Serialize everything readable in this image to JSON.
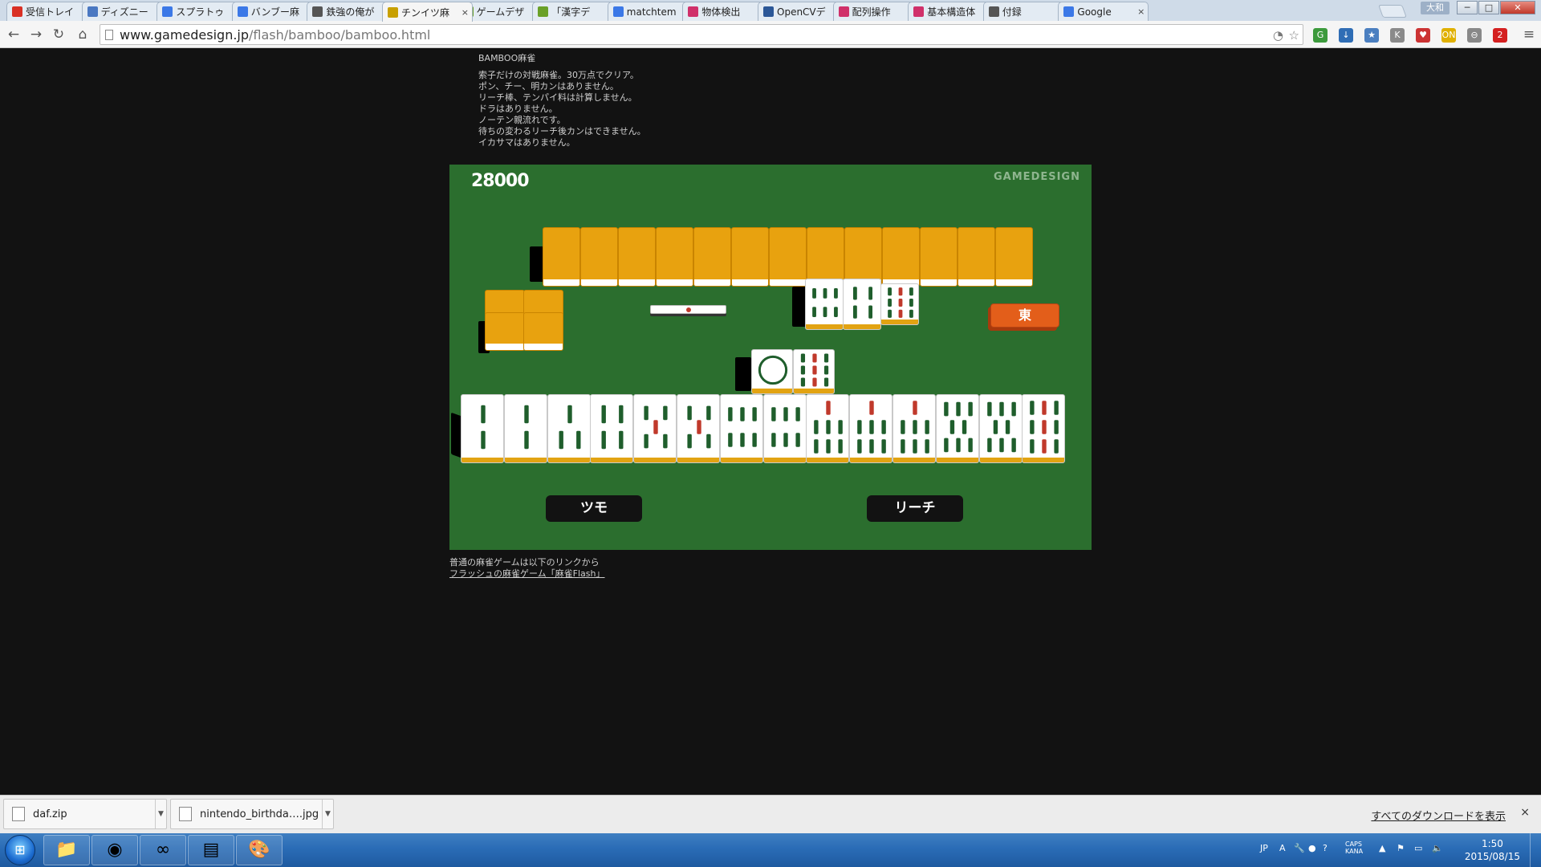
{
  "browser": {
    "tabs": [
      {
        "title": "受信トレイ",
        "icon": "gmail-icon",
        "color": "#d93025"
      },
      {
        "title": "ディズニー",
        "icon": "page-icon",
        "color": "#4a78c2"
      },
      {
        "title": "スプラトゥ",
        "icon": "google-icon",
        "color": "#3b78e7"
      },
      {
        "title": "バンブー麻",
        "icon": "google-icon",
        "color": "#3b78e7"
      },
      {
        "title": "鉄強の俺が",
        "icon": "page-icon",
        "color": "#555555"
      },
      {
        "title": "チンイツ麻",
        "icon": "gamedesign-icon",
        "color": "#c8a000",
        "active": true
      },
      {
        "title": "ゲームデザ",
        "icon": "gamedesign-icon",
        "color": "#6aa028"
      },
      {
        "title": "「漢字デ",
        "icon": "gamedesign-icon",
        "color": "#6aa028"
      },
      {
        "title": "matchtem",
        "icon": "google-icon",
        "color": "#3b78e7"
      },
      {
        "title": "物体検出",
        "icon": "qiita-icon",
        "color": "#d0306a"
      },
      {
        "title": "OpenCVデ",
        "icon": "table-icon",
        "color": "#2b5797"
      },
      {
        "title": "配列操作",
        "icon": "qiita-icon",
        "color": "#d0306a"
      },
      {
        "title": "基本構造体",
        "icon": "qiita-icon",
        "color": "#d0306a"
      },
      {
        "title": "付録",
        "icon": "page-icon",
        "color": "#555555"
      },
      {
        "title": "Google",
        "icon": "google-icon",
        "color": "#3b78e7"
      }
    ],
    "user_label": "大和",
    "window_buttons": [
      "─",
      "□",
      "✕"
    ],
    "url_host": "www.gamedesign.jp",
    "url_path": "/flash/bamboo/bamboo.html",
    "extensions": [
      {
        "label": "G",
        "color": "#3c9a3c"
      },
      {
        "label": "↓",
        "color": "#2f6db5"
      },
      {
        "label": "★",
        "color": "#4b7fc0"
      },
      {
        "label": "K",
        "color": "#8a8a8a"
      },
      {
        "label": "♥",
        "color": "#cc3333"
      },
      {
        "label": "ON",
        "color": "#e0b000"
      },
      {
        "label": "⊖",
        "color": "#888888"
      },
      {
        "label": "2",
        "color": "#d42020"
      }
    ]
  },
  "description": {
    "title": "BAMBOO麻雀",
    "lines": [
      "索子だけの対戦麻雀。30万点でクリア。",
      "ポン、チー、明カンはありません。",
      "リーチ棒、テンパイ料は計算しません。",
      "ドラはありません。",
      "ノーテン親流れです。",
      "待ちの変わるリーチ後カンはできません。",
      "イカサマはありません。"
    ]
  },
  "game": {
    "score": "28000",
    "brand": "GAMEDESIGN",
    "east_marker": "東",
    "opponent_hand_count": 13,
    "player_hand": [
      2,
      2,
      3,
      4,
      5,
      5,
      6,
      6,
      7,
      7,
      7,
      8,
      8,
      9
    ],
    "opponent_discards": [
      6,
      4,
      9
    ],
    "player_discards": [
      "1s",
      9
    ],
    "side_stack_rows": 2,
    "buttons": {
      "tsumo": "ツモ",
      "riichi": "リーチ"
    },
    "colors": {
      "felt": "#2b6e2e",
      "tile_back": "#e8a20f",
      "bamboo_green": "#1f5e2c",
      "bamboo_red": "#c0392b",
      "marker": "#e35e1a"
    }
  },
  "footer": {
    "note": "普通の麻雀ゲームは以下のリンクから",
    "link": "フラッシュの麻雀ゲーム「麻雀Flash」"
  },
  "downloads": {
    "items": [
      {
        "name": "daf.zip"
      },
      {
        "name": "nintendo_birthda….jpg"
      }
    ],
    "show_all": "すべてのダウンロードを表示",
    "close": "×"
  },
  "taskbar": {
    "start_icon": "windows-logo-icon",
    "apps": [
      {
        "icon": "folder-icon",
        "glyph": "📁"
      },
      {
        "icon": "chrome-icon",
        "glyph": "◉"
      },
      {
        "icon": "app-icon",
        "glyph": "∞"
      },
      {
        "icon": "notes-icon",
        "glyph": "▤"
      },
      {
        "icon": "paint-icon",
        "glyph": "🎨"
      }
    ],
    "tray": {
      "language": "JP",
      "ime": "A",
      "caps": "CAPS",
      "kana": "KANA"
    },
    "time": "1:50",
    "date": "2015/08/15"
  }
}
